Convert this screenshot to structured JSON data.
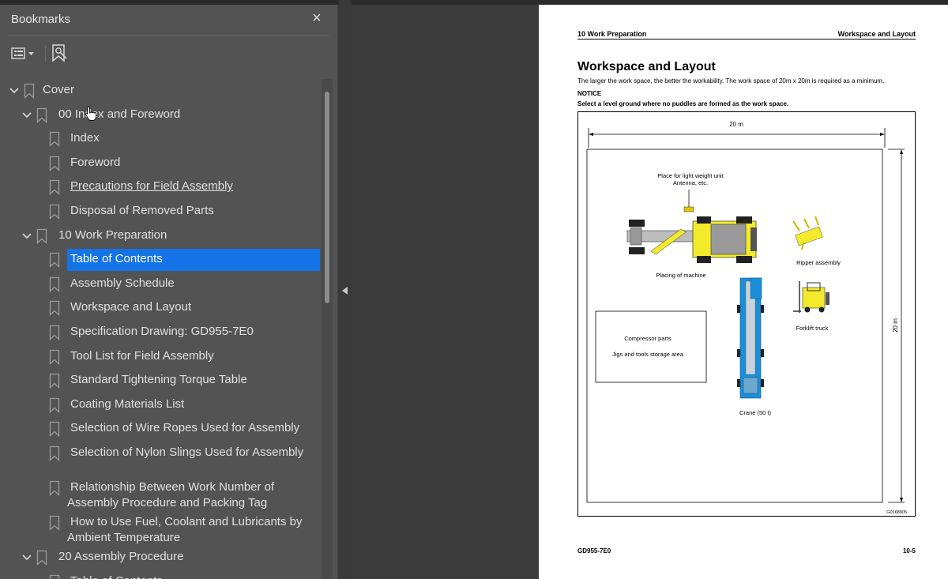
{
  "sidebar": {
    "title": "Bookmarks",
    "close_icon": "×",
    "items": [
      {
        "label": "Cover",
        "level": 0,
        "expanded": true
      },
      {
        "label": "00 Index and Foreword",
        "level": 1,
        "expanded": true
      },
      {
        "label": "Index",
        "level": 2
      },
      {
        "label": "Foreword",
        "level": 2
      },
      {
        "label": "Precautions for Field Assembly",
        "level": 2,
        "underlined": true
      },
      {
        "label": "Disposal of Removed Parts",
        "level": 2
      },
      {
        "label": "10 Work Preparation",
        "level": 1,
        "expanded": true
      },
      {
        "label": "Table of Contents",
        "level": 2,
        "selected": true
      },
      {
        "label": "Assembly Schedule",
        "level": 2
      },
      {
        "label": "Workspace and Layout",
        "level": 2
      },
      {
        "label": "Specification Drawing: GD955-7E0",
        "level": 2
      },
      {
        "label": "Tool List for Field Assembly",
        "level": 2
      },
      {
        "label": "Standard Tightening Torque Table",
        "level": 2
      },
      {
        "label": "Coating Materials List",
        "level": 2
      },
      {
        "label": "Selection of Wire Ropes Used for Assembly",
        "level": 2
      },
      {
        "label": "Selection of Nylon Slings Used for Assembly",
        "level": 2
      },
      {
        "label": "Relationship Between Work Number of Assembly Procedure and Packing Tag",
        "level": 2
      },
      {
        "label": "How to Use Fuel, Coolant and Lubricants by Ambient Temperature",
        "level": 2
      },
      {
        "label": "20 Assembly Procedure",
        "level": 1,
        "expanded": true
      },
      {
        "label": "Table of Contents",
        "level": 2
      }
    ]
  },
  "page": {
    "header_left": "10 Work Preparation",
    "header_right": "Workspace and Layout",
    "title": "Workspace and Layout",
    "intro": "The larger the work space, the better the workability. The work space of 20m x 20m is required as a minimum.",
    "notice_label": "NOTICE",
    "notice_text": "Select a level ground where no puddles are formed as the work space.",
    "figure": {
      "width_dim": "20 m",
      "height_dim": "20 m",
      "light_unit_label_1": "Place for light weight unit",
      "light_unit_label_2": "Antenna, etc.",
      "machine_label": "Placing of machine",
      "ripper_label": "Ripper assembly",
      "forklift_label": "Forklift truck",
      "compressor_label": "Compressor parts",
      "jigs_label": "Jigs and tools storage area",
      "crane_label": "Crane (50 t)",
      "fig_code": "G0168905"
    },
    "footer_left": "GD955-7E0",
    "footer_right": "10-5"
  },
  "colors": {
    "selected": "#1473e6",
    "sidebar_bg": "#535353",
    "machine_yellow": "#f2ea2a",
    "crane_blue": "#1a8fd8"
  }
}
